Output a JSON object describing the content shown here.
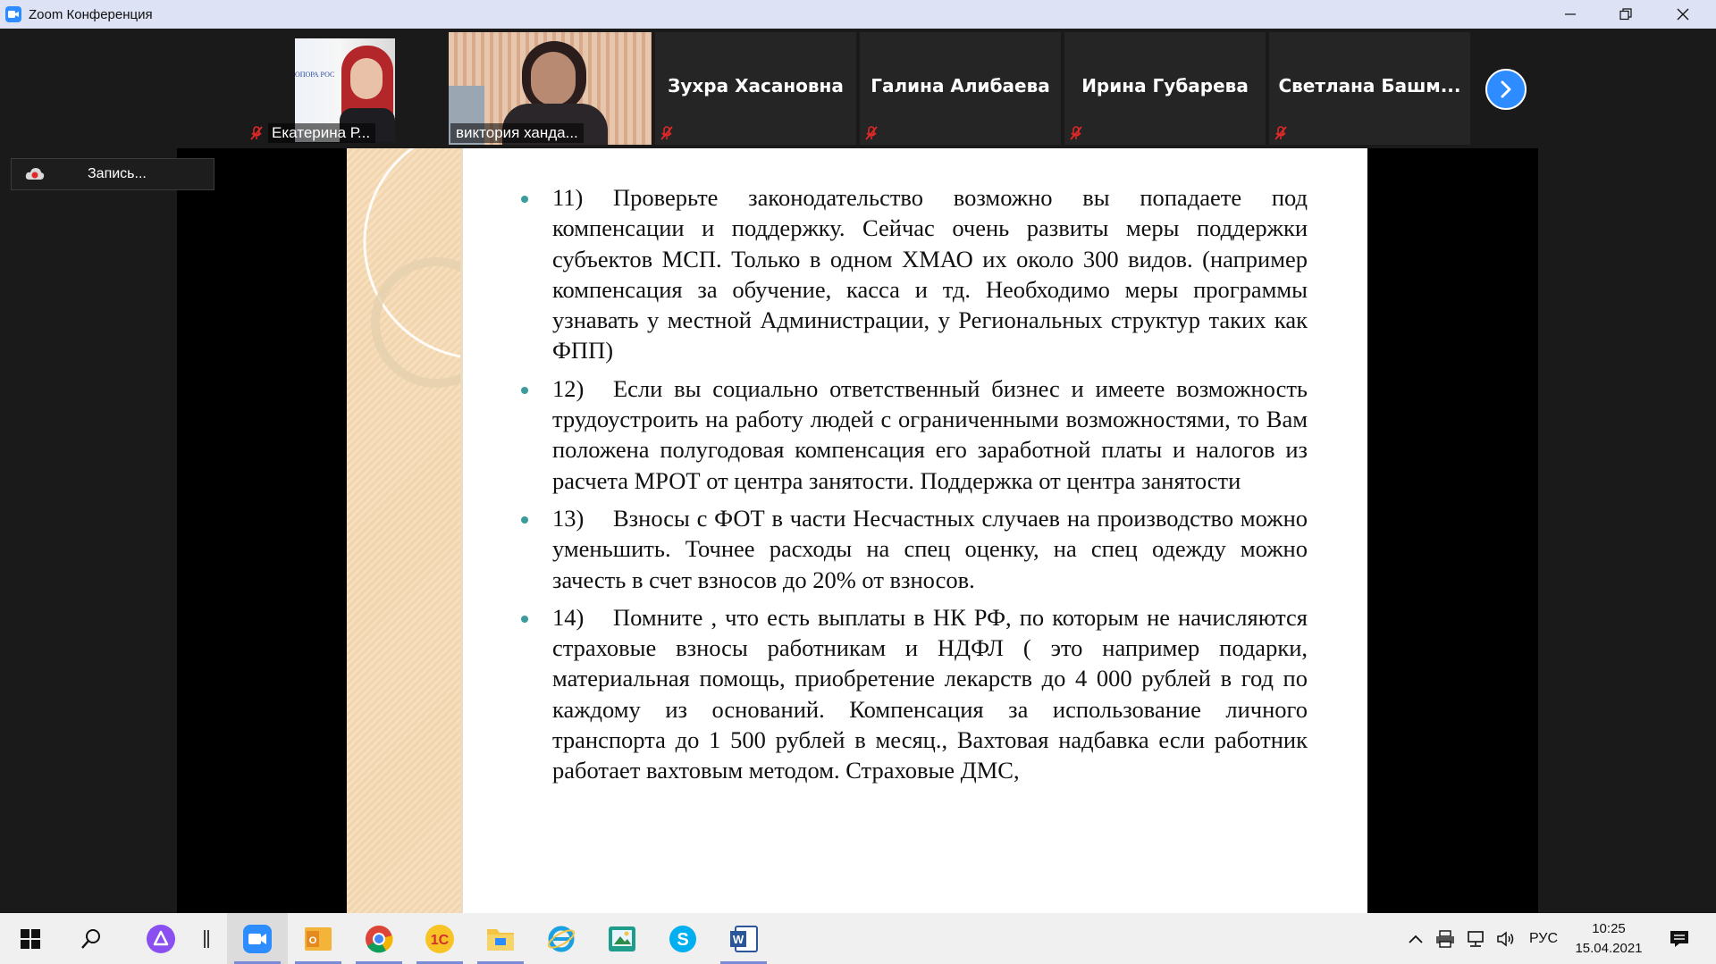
{
  "window": {
    "title": "Zoom Конференция",
    "minimize_icon": "minimize-icon",
    "maximize_icon": "restore-icon",
    "close_icon": "close-icon"
  },
  "participants": [
    {
      "name": "Екатерина Р...",
      "type": "video",
      "muted": true,
      "photo_text": "ОПОРА РОС"
    },
    {
      "name": "виктория ханда...",
      "type": "video",
      "muted": false,
      "active_speaker": true
    },
    {
      "name": "Зухра Хасановна",
      "type": "name",
      "muted": true
    },
    {
      "name": "Галина Алибаева",
      "type": "name",
      "muted": true
    },
    {
      "name": "Ирина Губарева",
      "type": "name",
      "muted": true
    },
    {
      "name": "Светлана  Башм...",
      "type": "name",
      "muted": true
    }
  ],
  "recording": {
    "label": "Запись..."
  },
  "slide": {
    "items": [
      {
        "number": "11)",
        "text": "Проверьте законодательство возможно вы попадаете под компенсации и поддержку. Сейчас очень развиты меры поддержки субъектов МСП. Только в одном ХМАО их около 300 видов. (например  компенсация за обучение, касса  и тд. Необходимо меры программы узнавать у местной Администрации, у Региональных структур таких как ФПП)"
      },
      {
        "number": "12)",
        "text": "Если вы социально ответственный бизнес и имеете возможность трудоустроить  на работу людей с ограниченными возможностями, то Вам положена полугодовая компенсация его заработной платы и налогов из расчета МРОТ от центра занятости. Поддержка от центра занятости"
      },
      {
        "number": "13)",
        "text": "Взносы с ФОТ в части Несчастных случаев на производство можно уменьшить. Точнее расходы на спец оценку, на спец одежду можно зачесть в счет взносов до 20% от взносов."
      },
      {
        "number": "14)",
        "text": "Помните , что есть выплаты в НК РФ,  по которым не начисляются страховые взносы работникам и НДФЛ ( это например подарки, материальная помощь, приобретение лекарств  до 4 000 рублей в год по каждому из оснований. Компенсация за использование личного транспорта до 1 500 рублей в месяц., Вахтовая надбавка если работник работает вахтовым методом. Страховые ДМС,"
      }
    ]
  },
  "taskbar": {
    "apps": [
      "start-icon",
      "search-icon",
      "alice-icon",
      "zoom-icon",
      "outlook-icon",
      "chrome-icon",
      "1c-icon",
      "explorer-icon",
      "ie-icon",
      "photos-icon",
      "skype-icon",
      "word-icon"
    ],
    "language": "РУС",
    "time": "10:25",
    "date": "15.04.2021"
  }
}
